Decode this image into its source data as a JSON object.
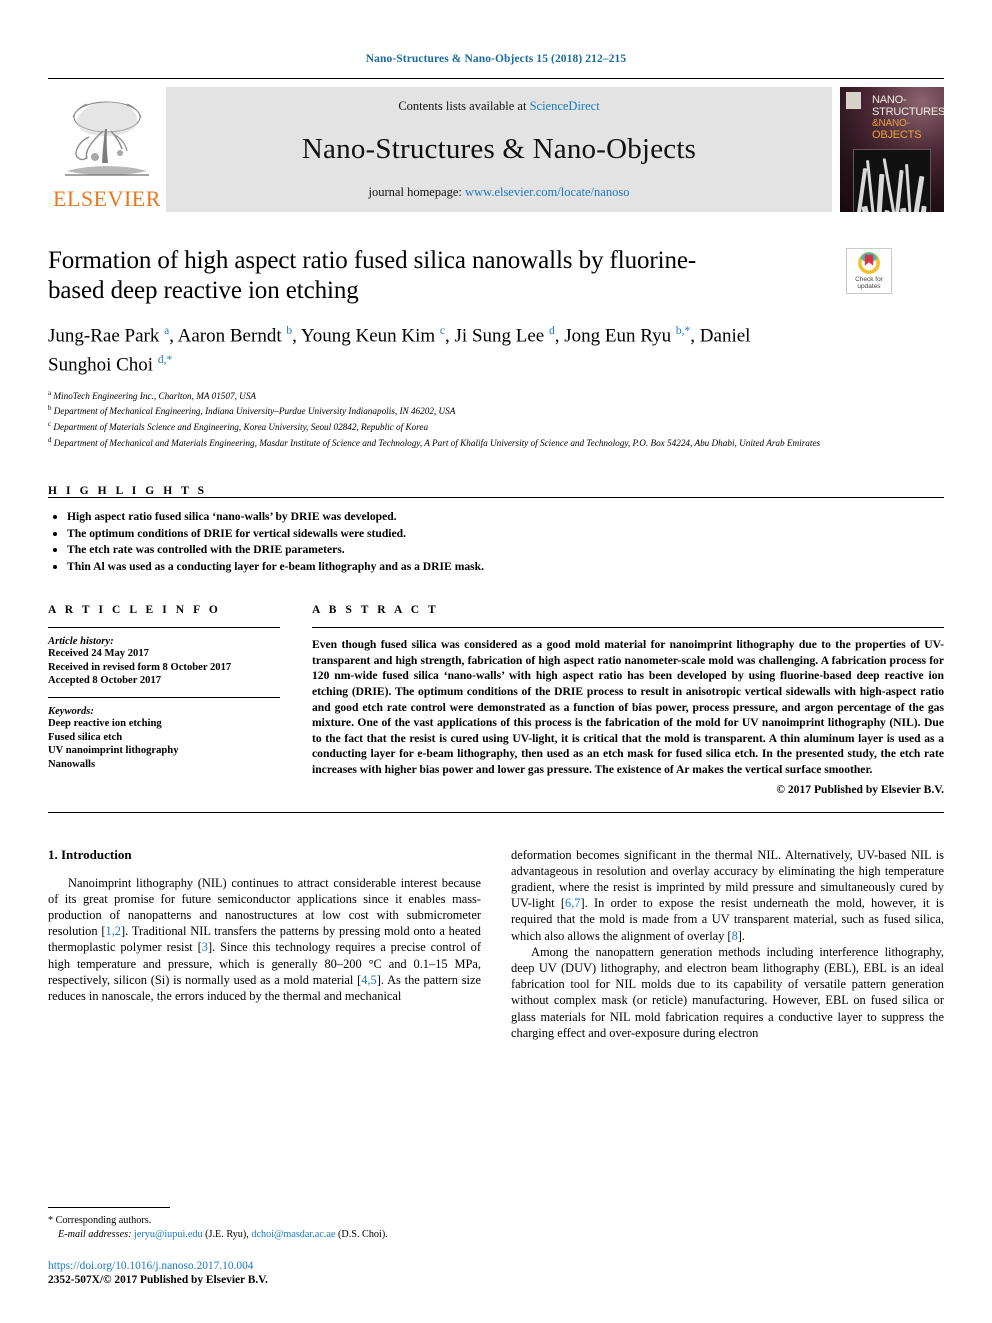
{
  "running_head": "Nano-Structures & Nano-Objects 15 (2018) 212–215",
  "masthead": {
    "publisher": "ELSEVIER",
    "contents_prefix": "Contents lists available at ",
    "contents_link": "ScienceDirect",
    "journal_name": "Nano-Structures & Nano-Objects",
    "homepage_prefix": "journal homepage: ",
    "homepage_url": "www.elsevier.com/locate/nanoso",
    "cover_title_line1": "NANO-",
    "cover_title_line2": "STRUCTURES",
    "cover_title_line3": "&NANO-",
    "cover_title_line4": "OBJECTS"
  },
  "crossmark": {
    "line1": "Check for",
    "line2": "updates"
  },
  "title": "Formation of high aspect ratio fused silica nanowalls by fluorine-based deep reactive ion etching",
  "authors_html": "Jung-Rae Park <sup>a</sup>, Aaron Berndt <sup>b</sup>, Young Keun Kim <sup>c</sup>, Ji Sung Lee <sup>d</sup>, Jong Eun Ryu <sup>b,*</sup>, Daniel Sunghoi Choi <sup>d,*</sup>",
  "affiliations": [
    {
      "mark": "a",
      "text": "MinoTech Engineering Inc., Charlton, MA 01507, USA"
    },
    {
      "mark": "b",
      "text": "Department of Mechanical Engineering, Indiana University–Purdue University Indianapolis, IN 46202, USA"
    },
    {
      "mark": "c",
      "text": "Department of Materials Science and Engineering, Korea University, Seoul 02842, Republic of Korea"
    },
    {
      "mark": "d",
      "text": "Department of Mechanical and Materials Engineering, Masdar Institute of Science and Technology, A Part of Khalifa University of Science and Technology, P.O. Box 54224, Abu Dhabi, United Arab Emirates"
    }
  ],
  "highlights": {
    "label": "H I G H L I G H T S",
    "items": [
      "High aspect ratio fused silica ‘nano-walls’ by DRIE was developed.",
      "The optimum conditions of DRIE for vertical sidewalls were studied.",
      "The etch rate was controlled with the DRIE parameters.",
      "Thin Al was used as a conducting layer for e-beam lithography and as a DRIE mask."
    ]
  },
  "article_info": {
    "label": "A R T I C L E    I N F O",
    "history_heading": "Article history:",
    "history": [
      "Received 24 May 2017",
      "Received in revised form 8 October 2017",
      "Accepted 8 October 2017"
    ],
    "keywords_heading": "Keywords:",
    "keywords": [
      "Deep reactive ion etching",
      "Fused silica etch",
      "UV nanoimprint lithography",
      "Nanowalls"
    ]
  },
  "abstract": {
    "label": "A B S T R A C T",
    "text": "Even though fused silica was considered as a good mold material for nanoimprint lithography due to the properties of UV-transparent and high strength, fabrication of high aspect ratio nanometer-scale mold was challenging. A fabrication process for 120 nm-wide fused silica ‘nano-walls’ with high aspect ratio has been developed by using fluorine-based deep reactive ion etching (DRIE). The optimum conditions of the DRIE process to result in anisotropic vertical sidewalls with high-aspect ratio and good etch rate control were demonstrated as a function of bias power, process pressure, and argon percentage of the gas mixture. One of the vast applications of this process is the fabrication of the mold for UV nanoimprint lithography (NIL). Due to the fact that the resist is cured using UV-light, it is critical that the mold is transparent. A thin aluminum layer is used as a conducting layer for e-beam lithography, then used as an etch mask for fused silica etch. In the presented study, the etch rate increases with higher bias power and lower gas pressure. The existence of Ar makes the vertical surface smoother.",
    "copyright": "© 2017 Published by Elsevier B.V."
  },
  "body": {
    "section_number_title": "1.  Introduction",
    "left_paragraph_html": "Nanoimprint lithography (NIL) continues to attract considerable interest because of its great promise for future semiconductor applications since it enables mass-production of nanopatterns and nanostructures at low cost with submicrometer resolution [<span class=\"ref\">1,2</span>]. Traditional NIL transfers the patterns by pressing mold onto a heated thermoplastic polymer resist [<span class=\"ref\">3</span>]. Since this technology requires a precise control of high temperature and pressure, which is generally 80–200 °C and 0.1–15 MPa, respectively, silicon (Si) is normally used as a mold material [<span class=\"ref\">4,5</span>]. As the pattern size reduces in nanoscale, the errors induced by the thermal and mechanical",
    "right_paragraph1_html": "deformation becomes significant in the thermal NIL. Alternatively, UV-based NIL is advantageous in resolution and overlay accuracy by eliminating the high temperature gradient, where the resist is imprinted by mild pressure and simultaneously cured by UV-light [<span class=\"ref\">6,7</span>]. In order to expose the resist underneath the mold, however, it is required that the mold is made from a UV transparent material, such as fused silica, which also allows the alignment of overlay [<span class=\"ref\">8</span>].",
    "right_paragraph2_html": "Among the nanopattern generation methods including interference lithography, deep UV (DUV) lithography, and electron beam lithography (EBL), EBL is an ideal fabrication tool for NIL molds due to its capability of versatile pattern generation without complex mask (or reticle) manufacturing. However, EBL on fused silica or glass materials for NIL mold fabrication requires a conductive layer to suppress the charging effect and over-exposure during electron"
  },
  "footnote": {
    "corresponding": "* Corresponding authors.",
    "email_label": "E-mail addresses:",
    "email1": "jeryu@iupui.edu",
    "email1_who": "(J.E. Ryu),",
    "email2": "dchoi@masdar.ac.ae",
    "email2_who": "(D.S. Choi)."
  },
  "doc_footer": {
    "doi": "https://doi.org/10.1016/j.nanoso.2017.10.004",
    "issn": "2352-507X/© 2017 Published by Elsevier B.V."
  },
  "colors": {
    "link": "#1a79c4",
    "running_head": "#1a6b9e",
    "elsevier_orange": "#E87722",
    "masthead_bg": "#e3e3e3"
  }
}
